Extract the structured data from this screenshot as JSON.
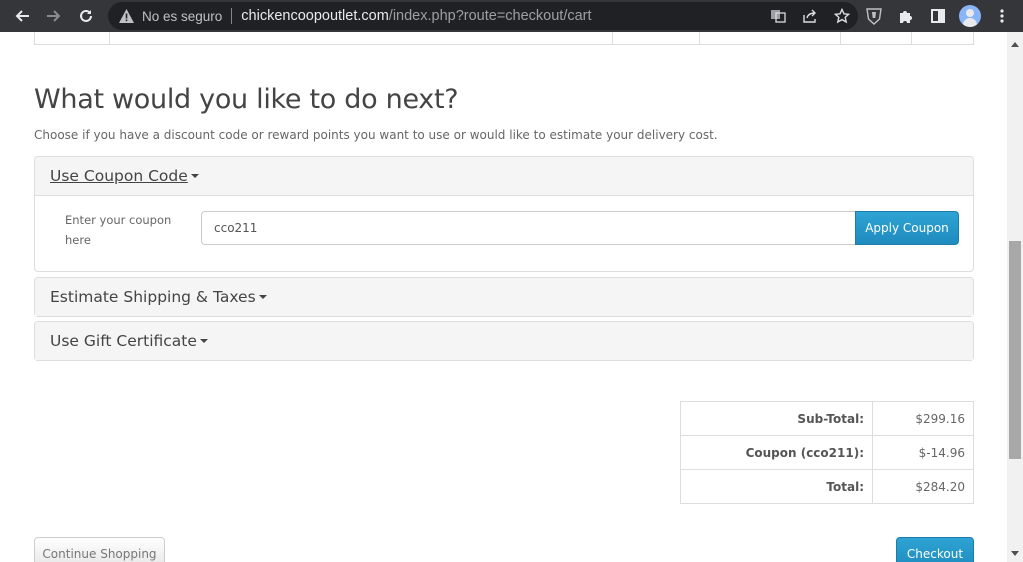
{
  "browser": {
    "security_label": "No es seguro",
    "url_host": "chickencoopoutlet.com",
    "url_path": "/index.php?route=checkout/cart",
    "icons": [
      "back-icon",
      "forward-icon",
      "reload-icon",
      "warning-icon",
      "translate-icon",
      "share-icon",
      "bookmark-star-icon",
      "shield-extension-icon",
      "extensions-puzzle-icon",
      "side-panel-icon",
      "profile-avatar-icon",
      "menu-kebab-icon"
    ]
  },
  "page": {
    "title": "What would you like to do next?",
    "subtitle": "Choose if you have a discount code or reward points you want to use or would like to estimate your delivery cost.",
    "panels": {
      "coupon": {
        "heading": "Use Coupon Code",
        "label": "Enter your coupon here",
        "input_value": "cco211",
        "button": "Apply Coupon"
      },
      "shipping": {
        "heading": "Estimate Shipping & Taxes"
      },
      "gift": {
        "heading": "Use Gift Certificate"
      }
    },
    "totals": [
      {
        "label": "Sub-Total:",
        "value": "$299.16"
      },
      {
        "label": "Coupon (cco211):",
        "value": "$-14.96"
      },
      {
        "label": "Total:",
        "value": "$284.20"
      }
    ],
    "buttons": {
      "continue": "Continue Shopping",
      "checkout": "Checkout"
    }
  }
}
